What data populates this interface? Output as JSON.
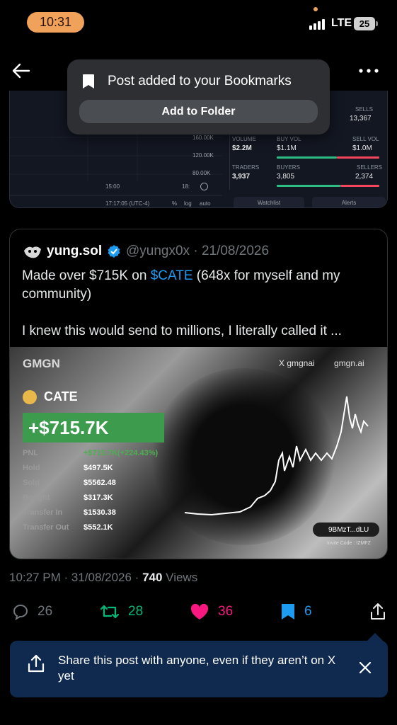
{
  "status_bar": {
    "time": "10:31",
    "network": "LTE",
    "battery": "25"
  },
  "header": {
    "more_label": "•••"
  },
  "embedded_chart": {
    "y_ticks": [
      "160.00K",
      "120.00K",
      "80.00K"
    ],
    "x_tick": "15:00",
    "interval": "18:",
    "timestamp": "17:17:05 (UTC-4)",
    "controls": [
      "%",
      "log",
      "auto"
    ],
    "stats": {
      "sells_label": "SELLS",
      "sells_value": "13,367",
      "volume_label": "VOLUME",
      "volume_value": "$2.2M",
      "buy_vol_label": "BUY VOL",
      "buy_vol_value": "$1.1M",
      "sell_vol_label": "SELL VOL",
      "sell_vol_value": "$1.0M",
      "traders_label": "TRADERS",
      "traders_value": "3,937",
      "buyers_label": "BUYERS",
      "buyers_value": "3,805",
      "sellers_label": "SELLERS",
      "sellers_value": "2,374"
    },
    "buttons": [
      "Watchlist",
      "Alerts"
    ]
  },
  "bookmark_popup": {
    "message": "Post added to your Bookmarks",
    "add_folder_label": "Add to Folder"
  },
  "quoted_post": {
    "name": "yung.sol",
    "handle": "@yungx0x · 21/08/2026",
    "text_before": "Made over $715K on ",
    "cashtag": "$CATE",
    "text_after": " (648x for myself and my community)",
    "text_line2": "I knew this would send to millions, I literally called it ...",
    "pnl_card": {
      "brand": "GMGN",
      "x_handle": "X gmgnai",
      "site": "gmgn.ai",
      "token": "CATE",
      "pnl_headline": "+$715.7K",
      "rows": [
        {
          "label": "PNL",
          "value": "+$715.7K(+224.43%)"
        },
        {
          "label": "Hold",
          "value": "$497.5K"
        },
        {
          "label": "Sold",
          "value": "$5562.48"
        },
        {
          "label": "Bought",
          "value": "$317.3K"
        },
        {
          "label": "Transfer In",
          "value": "$1530.38"
        },
        {
          "label": "Transfer Out",
          "value": "$552.1K"
        }
      ],
      "wallet": "9BMzT...dLU",
      "invite": "Invite Code : IZMFZ"
    }
  },
  "post_meta": {
    "time": "10:27 PM · 31/08/2026 · ",
    "views_count": "740",
    "views_label": " Views"
  },
  "actions": {
    "replies": "26",
    "reposts": "28",
    "likes": "36",
    "bookmarks": "6"
  },
  "colors": {
    "repost": "#00ba7c",
    "like": "#f91880",
    "bookmark": "#1d9bf0",
    "banner": "#0f2a4e"
  },
  "share_banner": {
    "text": "Share this post with anyone, even if they aren’t on X yet"
  }
}
